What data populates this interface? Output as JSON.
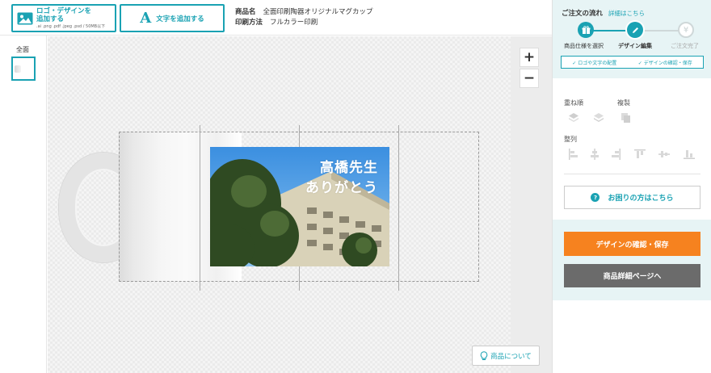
{
  "toolbar": {
    "add_logo_label_line1": "ロゴ・デザインを",
    "add_logo_label_line2": "追加する",
    "add_logo_formats": ".ai .png .pdf .jpeg .psd / 50MB以下",
    "add_text_glyph": "A",
    "add_text_label": "文字を追加する"
  },
  "product": {
    "name_key": "商品名",
    "name_value": "全面印刷陶器オリジナルマグカップ",
    "method_key": "印刷方法",
    "method_value": "フルカラー印刷"
  },
  "sidebar": {
    "view_label": "全面"
  },
  "zoom": {
    "in_label": "+",
    "out_label": "−"
  },
  "design": {
    "line1": "高橋先生",
    "line2": "ありがとう"
  },
  "about_button": "商品について",
  "order_flow": {
    "title": "ご注文の流れ",
    "detail_link": "詳細はこちら",
    "steps": [
      {
        "label": "商品仕様を選択",
        "state": "done",
        "icon": "gift-icon"
      },
      {
        "label": "デザイン編集",
        "state": "current",
        "icon": "pencil-icon"
      },
      {
        "label": "ご注文完了",
        "state": "todo",
        "icon": "yen-icon"
      }
    ],
    "checks": [
      "✓ ロゴや文字の配置",
      "✓ デザインの確認・保存"
    ]
  },
  "tools": {
    "layer_label": "重ね順",
    "duplicate_label": "複製",
    "align_label": "整列"
  },
  "help_button": "お困りの方はこちら",
  "save_button": "デザインの確認・保存",
  "detail_button": "商品詳細ページへ",
  "colors": {
    "accent": "#1aa2b3",
    "save": "#f6821f",
    "detail": "#6b6b6b",
    "panel_bg": "#e7f4f5"
  }
}
